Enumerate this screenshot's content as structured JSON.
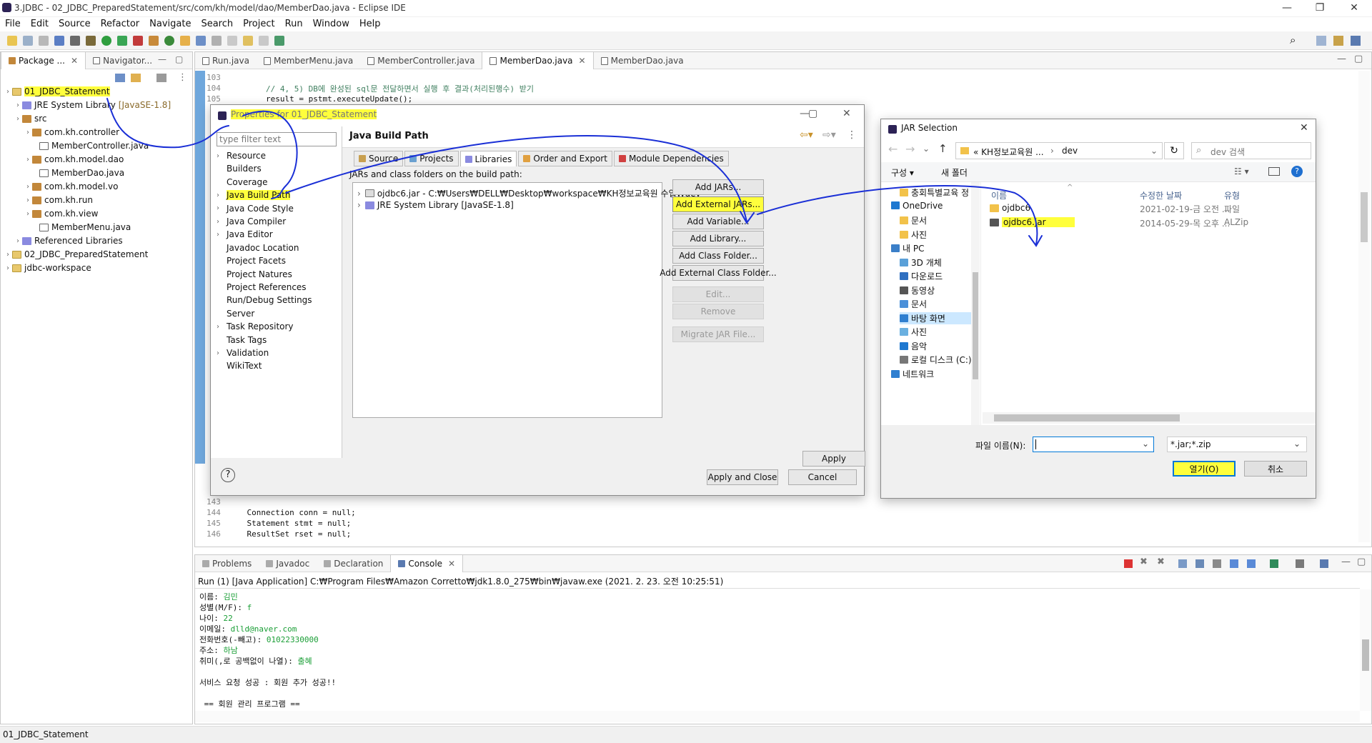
{
  "window": {
    "title": "3.JDBC - 02_JDBC_PreparedStatement/src/com/kh/model/dao/MemberDao.java - Eclipse IDE"
  },
  "menu": [
    "File",
    "Edit",
    "Source",
    "Refactor",
    "Navigate",
    "Search",
    "Project",
    "Run",
    "Window",
    "Help"
  ],
  "explorer": {
    "tabs": [
      "Package ...",
      "Navigator..."
    ],
    "items": [
      {
        "label": "01_JDBC_Statement",
        "indent": 0,
        "kind": "prj",
        "hl": true
      },
      {
        "label": "JRE System Library",
        "suffix": "[JavaSE-1.8]",
        "indent": 1,
        "kind": "lib"
      },
      {
        "label": "src",
        "indent": 1,
        "kind": "pkg"
      },
      {
        "label": "com.kh.controller",
        "indent": 2,
        "kind": "pkg"
      },
      {
        "label": "MemberController.java",
        "indent": 3,
        "kind": "jf"
      },
      {
        "label": "com.kh.model.dao",
        "indent": 2,
        "kind": "pkg"
      },
      {
        "label": "MemberDao.java",
        "indent": 3,
        "kind": "jf"
      },
      {
        "label": "com.kh.model.vo",
        "indent": 2,
        "kind": "pkg"
      },
      {
        "label": "com.kh.run",
        "indent": 2,
        "kind": "pkg"
      },
      {
        "label": "com.kh.view",
        "indent": 2,
        "kind": "pkg"
      },
      {
        "label": "MemberMenu.java",
        "indent": 3,
        "kind": "jf"
      },
      {
        "label": "Referenced Libraries",
        "indent": 1,
        "kind": "lib"
      },
      {
        "label": "02_JDBC_PreparedStatement",
        "indent": 0,
        "kind": "prj"
      },
      {
        "label": "jdbc-workspace",
        "indent": 0,
        "kind": "prj"
      }
    ]
  },
  "editor": {
    "tabs": [
      "Run.java",
      "MemberMenu.java",
      "MemberController.java",
      "MemberDao.java",
      "MemberDao.java"
    ],
    "active_tab": 3,
    "top_lines": [
      {
        "n": "103",
        "code": ""
      },
      {
        "n": "104",
        "code": "        // 4, 5) DB에 완성된 sql문 전달하면서 실행 후 결과(처리된행수) 받기"
      },
      {
        "n": "105",
        "code": "        result = pstmt.executeUpdate();"
      }
    ],
    "bottom_lines": [
      {
        "n": "143",
        "code": ""
      },
      {
        "n": "144",
        "code": "    Connection conn = null;"
      },
      {
        "n": "145",
        "code": "    Statement stmt = null;"
      },
      {
        "n": "146",
        "code": "    ResultSet rset = null;"
      }
    ]
  },
  "properties_dialog": {
    "title": "Properties for 01_JDBC_Statement",
    "filter_placeholder": "type filter text",
    "tree": [
      "Resource",
      "Builders",
      "Coverage",
      "Java Build Path",
      "Java Code Style",
      "Java Compiler",
      "Java Editor",
      "Javadoc Location",
      "Project Facets",
      "Project Natures",
      "Project References",
      "Run/Debug Settings",
      "Server",
      "Task Repository",
      "Task Tags",
      "Validation",
      "WikiText"
    ],
    "page_title": "Java Build Path",
    "tabs": [
      "Source",
      "Projects",
      "Libraries",
      "Order and Export",
      "Module Dependencies"
    ],
    "list_label": "JARs and class folders on the build path:",
    "entries": [
      "ojdbc6.jar - C:₩Users₩DELL₩Desktop₩workspace₩KH정보교육원 수업₩dev",
      "JRE System Library [JavaSE-1.8]"
    ],
    "buttons": [
      "Add JARs...",
      "Add External JARs...",
      "Add Variable...",
      "Add Library...",
      "Add Class Folder...",
      "Add External Class Folder...",
      "Edit...",
      "Remove",
      "Migrate JAR File..."
    ],
    "apply": "Apply",
    "apply_close": "Apply and Close",
    "cancel": "Cancel"
  },
  "jar_dialog": {
    "title": "JAR Selection",
    "path": [
      "« KH정보교육원 ...",
      "dev"
    ],
    "search_placeholder": "dev 검색",
    "toolbar": [
      "구성 ▾",
      "새 폴더"
    ],
    "nav": [
      {
        "label": "충회특별교육 정",
        "type": "folder"
      },
      {
        "label": "OneDrive",
        "type": "cloud"
      },
      {
        "label": "문서",
        "type": "folder"
      },
      {
        "label": "사진",
        "type": "folder"
      },
      {
        "label": "내 PC",
        "type": "pc"
      },
      {
        "label": "3D 개체",
        "type": "3d"
      },
      {
        "label": "다운로드",
        "type": "down"
      },
      {
        "label": "동영상",
        "type": "video"
      },
      {
        "label": "문서",
        "type": "doc"
      },
      {
        "label": "바탕 화면",
        "type": "desk"
      },
      {
        "label": "사진",
        "type": "pic"
      },
      {
        "label": "음악",
        "type": "music"
      },
      {
        "label": "로컬 디스크 (C:)",
        "type": "disk"
      },
      {
        "label": "네트워크",
        "type": "net"
      }
    ],
    "columns": [
      "이름",
      "수정한 날짜",
      "유형"
    ],
    "files": [
      {
        "name": "ojdbc6",
        "date": "2021-02-19-금 오전 ...",
        "type": "파일"
      },
      {
        "name": "ojdbc6.jar",
        "date": "2014-05-29-목 오후 ...",
        "type": "ALZip"
      }
    ],
    "filename_label": "파일 이름(N):",
    "filetype": "*.jar;*.zip",
    "open": "열기(O)",
    "cancel": "취소"
  },
  "console": {
    "tabs": [
      "Problems",
      "Javadoc",
      "Declaration",
      "Console"
    ],
    "header": "Run (1) [Java Application] C:₩Program Files₩Amazon Corretto₩jdk1.8.0_275₩bin₩javaw.exe  (2021. 2. 23. 오전 10:25:51)",
    "lines": [
      {
        "k": "이름: ",
        "v": "김민"
      },
      {
        "k": "성별(M/F): ",
        "v": "f"
      },
      {
        "k": "나이: ",
        "v": "22"
      },
      {
        "k": "이메일: ",
        "v": "dlld@naver.com"
      },
      {
        "k": "전화번호(-빼고): ",
        "v": "01022330000"
      },
      {
        "k": "주소: ",
        "v": "하남"
      },
      {
        "k": "취미(,로 공백없이 나열): ",
        "v": "출혜"
      },
      {
        "k": "",
        "v": ""
      },
      {
        "k": "서비스 요청 성공 : 회원 추가 성공!!",
        "v": ""
      },
      {
        "k": "",
        "v": ""
      },
      {
        "k": " == 회원 관리 프로그램 ==",
        "v": ""
      }
    ]
  },
  "status": {
    "text": "01_JDBC_Statement"
  },
  "colors": {
    "highlight": "#ffff3c",
    "annotation": "#1a2fd6",
    "eclipse_bg": "#f4f4f4"
  }
}
